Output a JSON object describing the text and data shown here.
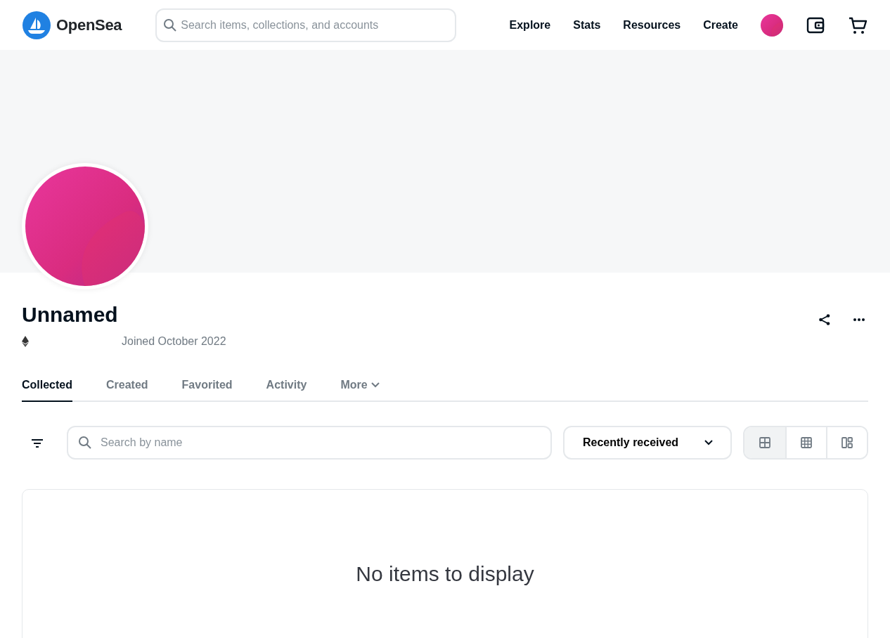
{
  "header": {
    "brand": "OpenSea",
    "search": {
      "placeholder": "Search items, collections, and accounts"
    },
    "nav": [
      "Explore",
      "Stats",
      "Resources",
      "Create"
    ]
  },
  "profile": {
    "name": "Unnamed",
    "joined": "Joined October 2022"
  },
  "tabs": [
    {
      "label": "Collected",
      "selected": true
    },
    {
      "label": "Created",
      "selected": false
    },
    {
      "label": "Favorited",
      "selected": false
    },
    {
      "label": "Activity",
      "selected": false
    },
    {
      "label": "More",
      "selected": false,
      "kind": "dropdown"
    }
  ],
  "toolbar": {
    "search": {
      "placeholder": "Search by name"
    },
    "sort": "Recently received",
    "views": [
      {
        "kind": "large",
        "selected": true
      },
      {
        "kind": "small",
        "selected": false
      },
      {
        "kind": "mixed",
        "selected": false
      }
    ]
  },
  "empty_message": "No items to display"
}
